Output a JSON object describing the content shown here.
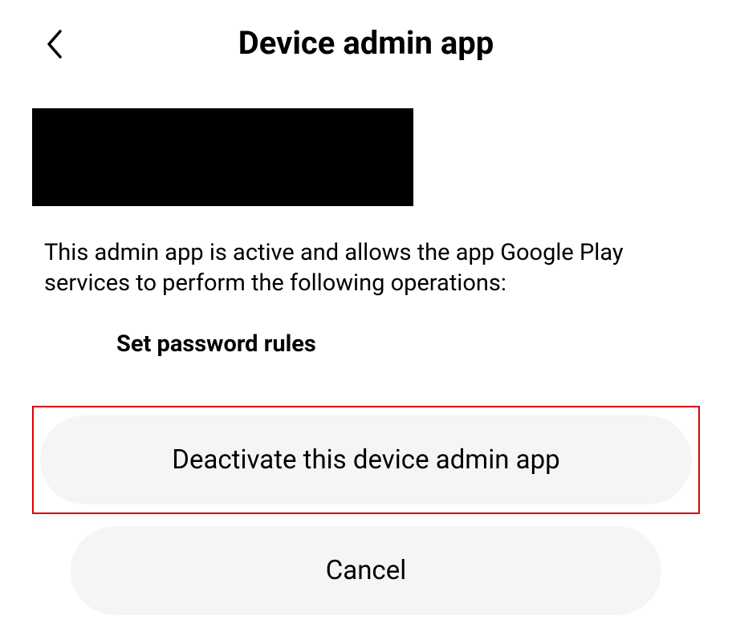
{
  "header": {
    "title": "Device admin app"
  },
  "content": {
    "description": "This admin app is active and allows the app Google Play services to perform the following operations:",
    "operations": [
      "Set password rules"
    ]
  },
  "buttons": {
    "deactivate": "Deactivate this device admin app",
    "cancel": "Cancel"
  }
}
